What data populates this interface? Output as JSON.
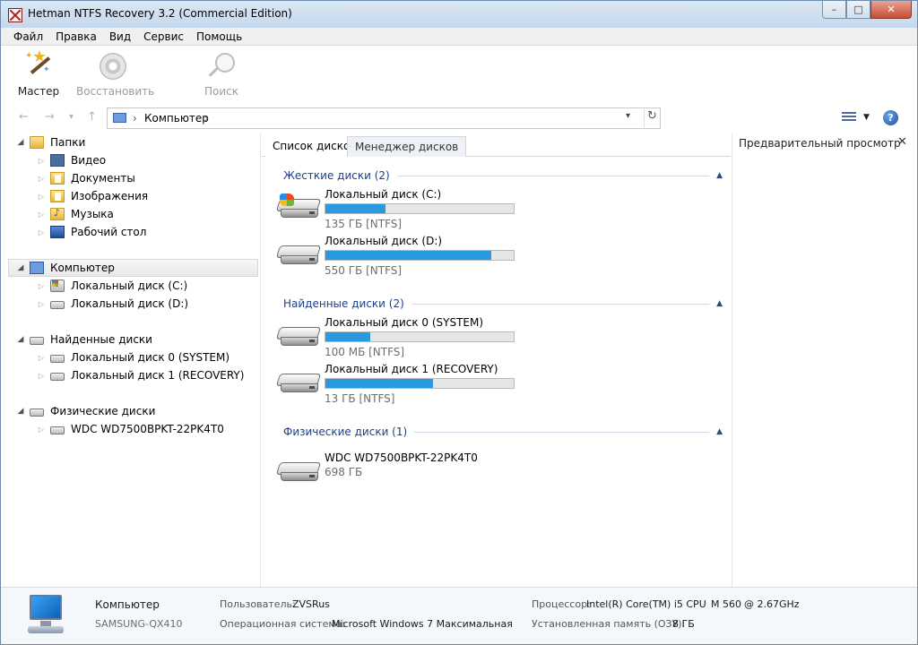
{
  "window": {
    "title": "Hetman NTFS Recovery 3.2 (Commercial Edition)",
    "buttons": {
      "minimize": "–",
      "maximize": "□",
      "close": "✕"
    }
  },
  "menu": [
    "Файл",
    "Правка",
    "Вид",
    "Сервис",
    "Помощь"
  ],
  "toolbar": {
    "wizard": "Мастер",
    "restore": "Восстановить",
    "search": "Поиск"
  },
  "address": {
    "back": "←",
    "forward": "→",
    "recent": "▾",
    "up": "↑",
    "separator": "›",
    "path": "Компьютер",
    "dropdown": "▾",
    "refresh": "↻",
    "view_dropdown": "▼",
    "help": "?"
  },
  "tree": {
    "folders_label": "Папки",
    "folders": [
      "Видео",
      "Документы",
      "Изображения",
      "Музыка",
      "Рабочий стол"
    ],
    "computer_label": "Компьютер",
    "computer_items": [
      "Локальный диск (C:)",
      "Локальный диск (D:)"
    ],
    "found_label": "Найденные диски",
    "found_items": [
      "Локальный диск 0 (SYSTEM)",
      "Локальный диск 1 (RECOVERY)"
    ],
    "physical_label": "Физические диски",
    "physical_items": [
      "WDC WD7500BPKT-22PK4T0"
    ],
    "expanded": "◢",
    "collapsed": "▷"
  },
  "tabs": {
    "disk_list": "Список дисков",
    "disk_manager": "Менеджер дисков"
  },
  "groups": {
    "hard": {
      "title": "Жесткие диски (2)",
      "chevron": "▲"
    },
    "found": {
      "title": "Найденные диски (2)",
      "chevron": "▲"
    },
    "physical": {
      "title": "Физические диски (1)",
      "chevron": "▲"
    }
  },
  "disks": [
    {
      "name": "Локальный диск (C:)",
      "info": "135 ГБ [NTFS]",
      "used_fraction": 0.32,
      "system": true
    },
    {
      "name": "Локальный диск (D:)",
      "info": "550 ГБ [NTFS]",
      "used_fraction": 0.88,
      "system": false
    },
    {
      "name": "Локальный диск 0 (SYSTEM)",
      "info": "100 МБ [NTFS]",
      "used_fraction": 0.24,
      "system": false
    },
    {
      "name": "Локальный диск 1 (RECOVERY)",
      "info": "13 ГБ [NTFS]",
      "used_fraction": 0.57,
      "system": false
    },
    {
      "name": "WDC WD7500BPKT-22PK4T0",
      "info": "698 ГБ",
      "used_fraction": null,
      "system": false
    }
  ],
  "preview": {
    "title": "Предварительный просмотр",
    "close": "✕"
  },
  "status": {
    "computer": "Компьютер",
    "model": "SAMSUNG-QX410",
    "user_label": "Пользователь:",
    "user_value": "ZVSRus",
    "os_label": "Операционная система:",
    "os_value": "Microsoft Windows 7 Максимальная",
    "cpu_label": "Процессор:",
    "cpu_value": "Intel(R) Core(TM) i5 CPU",
    "cpu_model": "M 560",
    "cpu_freq": "@ 2.67GHz",
    "ram_label": "Установленная память (ОЗУ):",
    "ram_value": "8 ГБ"
  },
  "colors": {
    "accent": "#2a9ae0",
    "group_header": "#1e3f87",
    "selection": "#e8e8e8"
  }
}
